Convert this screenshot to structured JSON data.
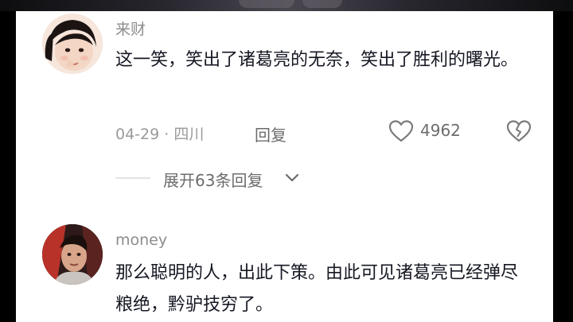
{
  "comments": [
    {
      "username": "来财",
      "text": "这一笑，笑出了诸葛亮的无奈，笑出了胜利的曙光。",
      "date_location": "04-29 · 四川",
      "reply_label": "回复",
      "like_count": "4962",
      "expand_label": "展开63条回复"
    },
    {
      "username": "money",
      "text": "那么聪明的人，出此下策。由此可见诸葛亮已经弹尽粮绝，黔驴技穷了。"
    }
  ],
  "icons": {
    "like": "heart-outline-icon",
    "dislike": "broken-heart-icon",
    "expand": "chevron-down-icon"
  },
  "colors": {
    "text_primary": "#161823",
    "text_secondary": "#8c8c8c",
    "background": "#ffffff",
    "backdrop": "#000000"
  }
}
